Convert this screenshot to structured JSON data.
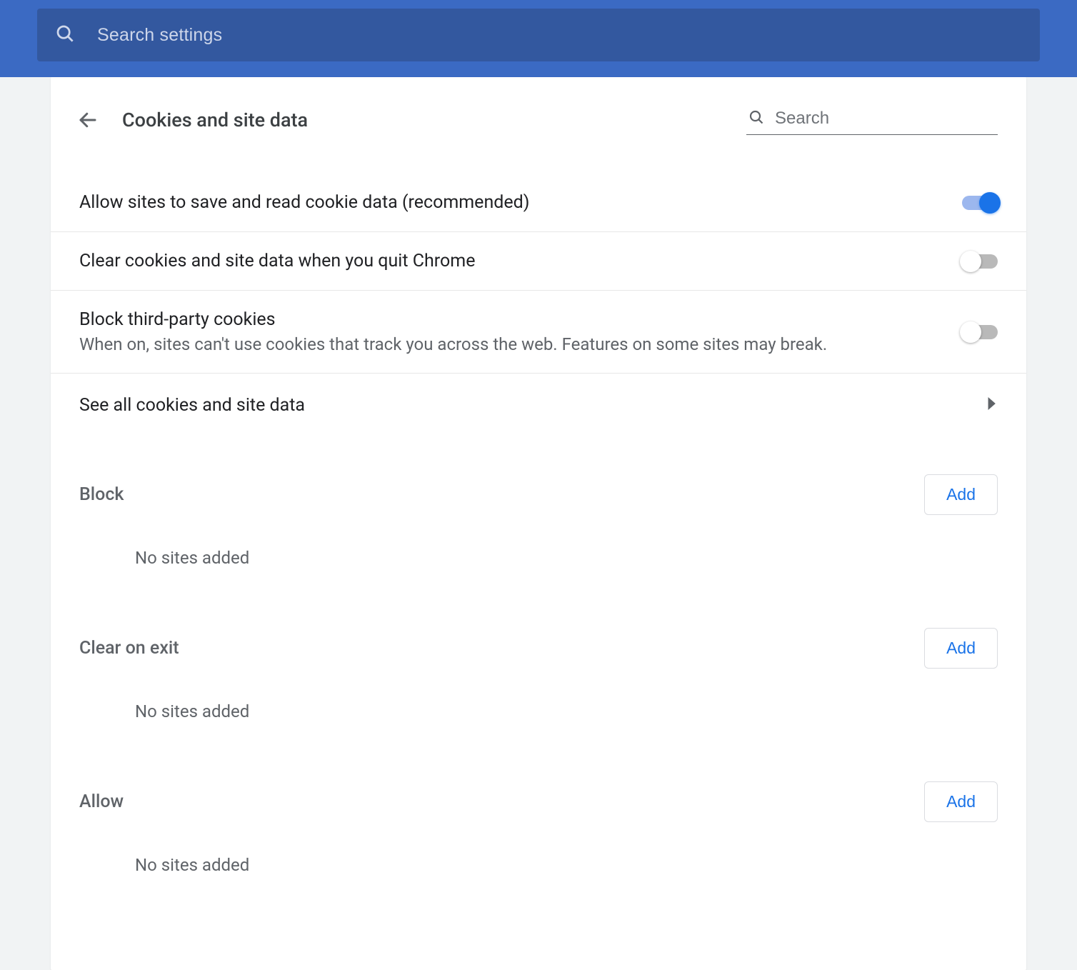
{
  "topbar": {
    "search_placeholder": "Search settings",
    "search_value": ""
  },
  "header": {
    "title": "Cookies and site data",
    "search_placeholder": "Search",
    "search_value": ""
  },
  "rows": {
    "allow_cookies": {
      "label": "Allow sites to save and read cookie data (recommended)",
      "on": true
    },
    "clear_on_quit": {
      "label": "Clear cookies and site data when you quit Chrome",
      "on": false
    },
    "block_third_party": {
      "label": "Block third-party cookies",
      "desc": "When on, sites can't use cookies that track you across the web. Features on some sites may break.",
      "on": false
    },
    "see_all": {
      "label": "See all cookies and site data"
    }
  },
  "sections": {
    "block": {
      "title": "Block",
      "empty": "No sites added",
      "add_label": "Add"
    },
    "clear_exit": {
      "title": "Clear on exit",
      "empty": "No sites added",
      "add_label": "Add"
    },
    "allow": {
      "title": "Allow",
      "empty": "No sites added",
      "add_label": "Add"
    }
  },
  "colors": {
    "accent": "#1a73e8",
    "topbar": "#3b6ac3"
  }
}
